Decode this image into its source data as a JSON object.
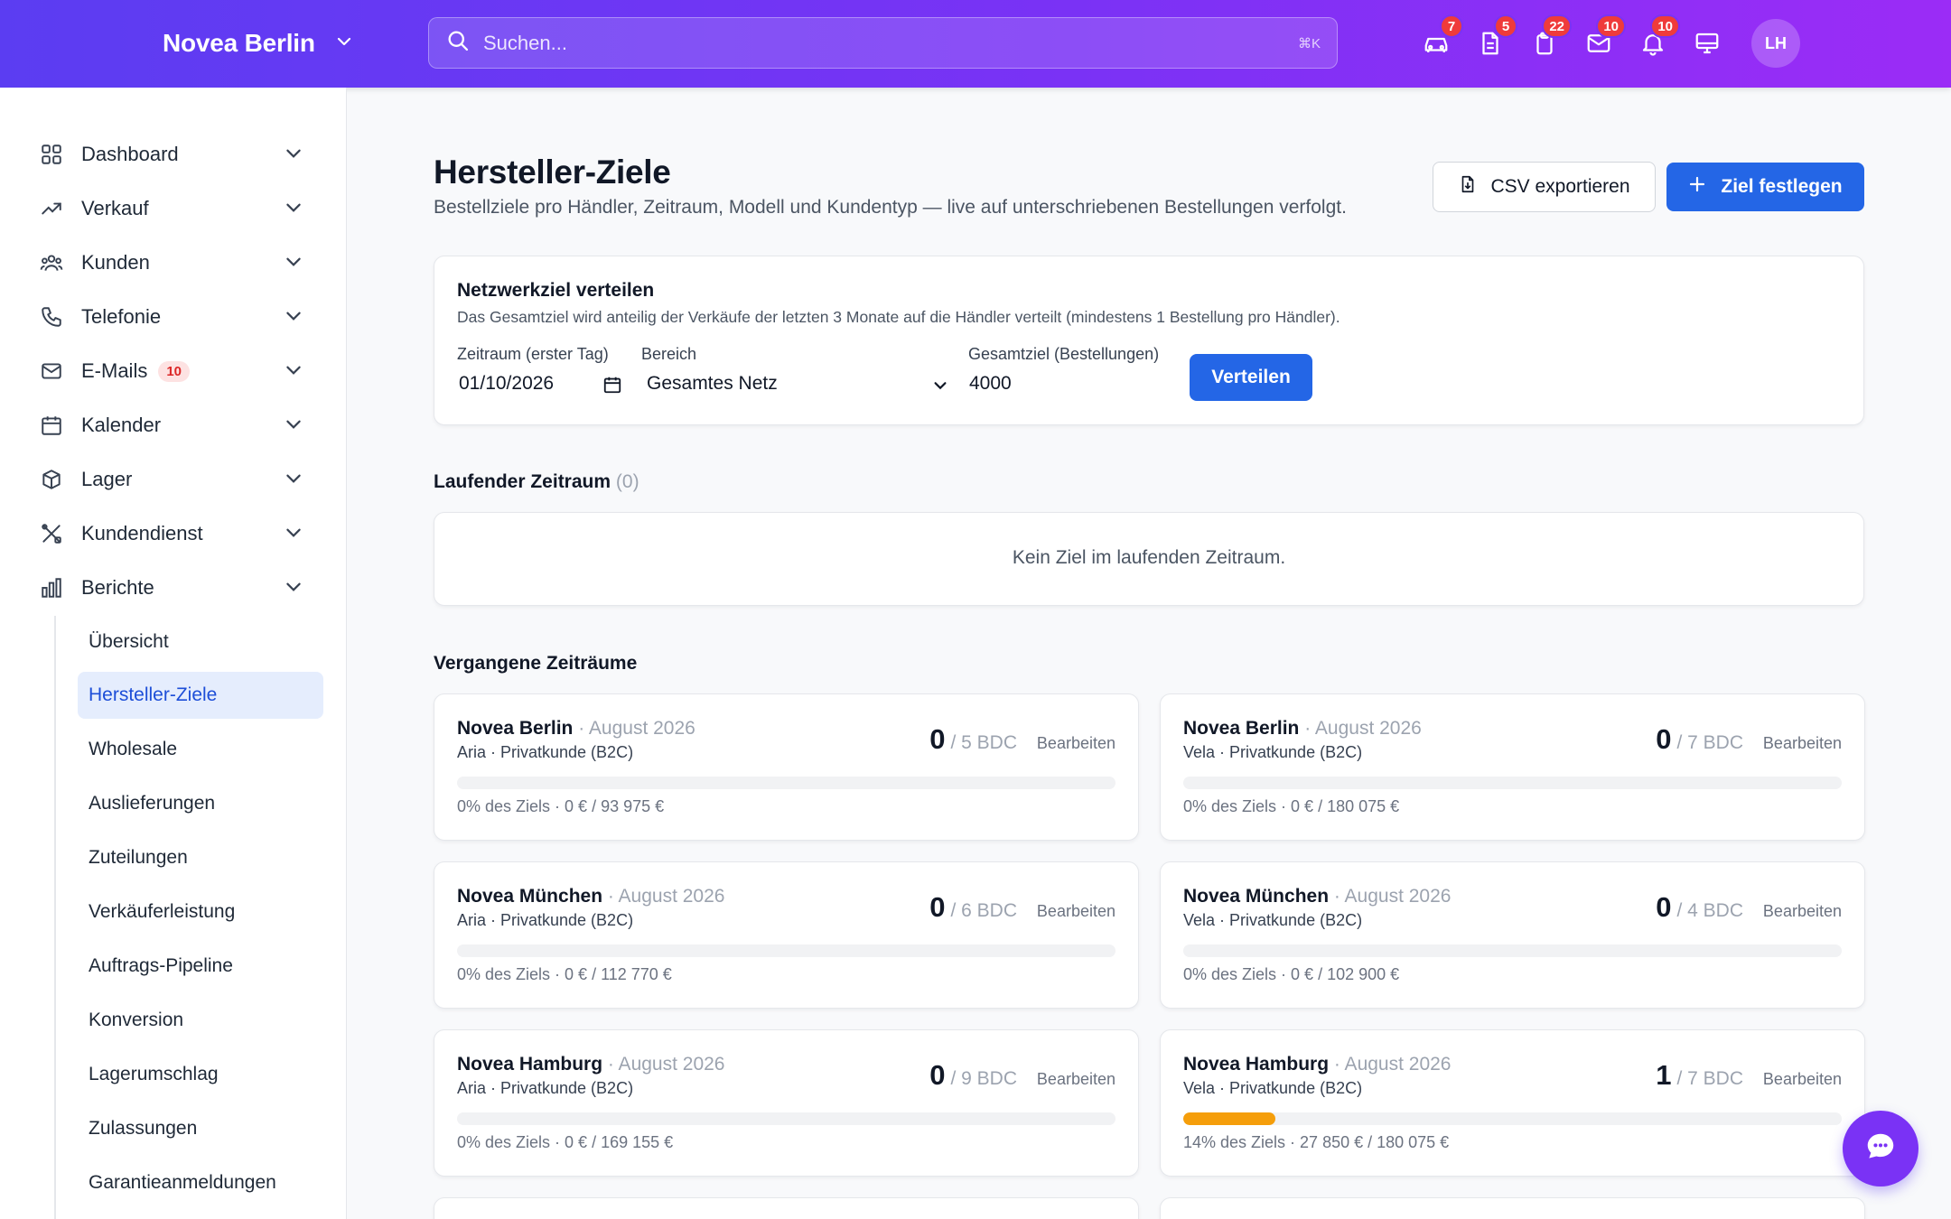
{
  "header": {
    "brand": "Novea Berlin",
    "search_placeholder": "Suchen...",
    "search_shortcut": "⌘K",
    "icons": [
      {
        "name": "car-icon",
        "badge": "7"
      },
      {
        "name": "document-icon",
        "badge": "5"
      },
      {
        "name": "clipboard-icon",
        "badge": "22"
      },
      {
        "name": "mail-icon",
        "badge": "10"
      },
      {
        "name": "bell-icon",
        "badge": "10"
      },
      {
        "name": "monitor-icon",
        "badge": ""
      }
    ],
    "avatar": "LH"
  },
  "sidebar": {
    "items": [
      {
        "label": "Dashboard",
        "icon": "grid-icon"
      },
      {
        "label": "Verkauf",
        "icon": "trending-up-icon"
      },
      {
        "label": "Kunden",
        "icon": "users-icon"
      },
      {
        "label": "Telefonie",
        "icon": "phone-icon"
      },
      {
        "label": "E-Mails",
        "icon": "mail-icon",
        "badge": "10"
      },
      {
        "label": "Kalender",
        "icon": "calendar-icon"
      },
      {
        "label": "Lager",
        "icon": "box-icon"
      },
      {
        "label": "Kundendienst",
        "icon": "tools-icon"
      },
      {
        "label": "Berichte",
        "icon": "bar-chart-icon"
      }
    ],
    "sub_items": [
      {
        "label": "Übersicht"
      },
      {
        "label": "Hersteller-Ziele",
        "active": true
      },
      {
        "label": "Wholesale"
      },
      {
        "label": "Auslieferungen"
      },
      {
        "label": "Zuteilungen"
      },
      {
        "label": "Verkäuferleistung"
      },
      {
        "label": "Auftrags-Pipeline"
      },
      {
        "label": "Konversion"
      },
      {
        "label": "Lagerumschlag"
      },
      {
        "label": "Zulassungen"
      },
      {
        "label": "Garantieanmeldungen"
      }
    ]
  },
  "page": {
    "title": "Hersteller-Ziele",
    "subtitle": "Bestellziele pro Händler, Zeitraum, Modell und Kundentyp — live auf unterschriebenen Bestellungen verfolgt.",
    "csv_button": "CSV exportieren",
    "primary_button": "Ziel festlegen"
  },
  "distribute": {
    "title": "Netzwerkziel verteilen",
    "description": "Das Gesamtziel wird anteilig der Verkäufe der letzten 3 Monate auf die Händler verteilt (mindestens 1 Bestellung pro Händler).",
    "period_label": "Zeitraum (erster Tag)",
    "period_value": "01/10/2026",
    "scope_label": "Bereich",
    "scope_value": "Gesamtes Netz",
    "total_label": "Gesamtziel (Bestellungen)",
    "total_value": "4000",
    "button": "Verteilen"
  },
  "current": {
    "title": "Laufender Zeitraum",
    "count": "(0)",
    "empty": "Kein Ziel im laufenden Zeitraum."
  },
  "past": {
    "title": "Vergangene Zeiträume",
    "edit_label": "Bearbeiten",
    "cards": [
      {
        "dealer": "Novea Berlin",
        "period": "· August 2026",
        "sub": "Aria · Privatkunde (B2C)",
        "actual": "0",
        "target": "/ 5 BDC",
        "progress": 0,
        "footer": "0% des Ziels · 0 € / 93 975 €"
      },
      {
        "dealer": "Novea Berlin",
        "period": "· August 2026",
        "sub": "Vela · Privatkunde (B2C)",
        "actual": "0",
        "target": "/ 7 BDC",
        "progress": 0,
        "footer": "0% des Ziels · 0 € / 180 075 €"
      },
      {
        "dealer": "Novea München",
        "period": "· August 2026",
        "sub": "Aria · Privatkunde (B2C)",
        "actual": "0",
        "target": "/ 6 BDC",
        "progress": 0,
        "footer": "0% des Ziels · 0 € / 112 770 €"
      },
      {
        "dealer": "Novea München",
        "period": "· August 2026",
        "sub": "Vela · Privatkunde (B2C)",
        "actual": "0",
        "target": "/ 4 BDC",
        "progress": 0,
        "footer": "0% des Ziels · 0 € / 102 900 €"
      },
      {
        "dealer": "Novea Hamburg",
        "period": "· August 2026",
        "sub": "Aria · Privatkunde (B2C)",
        "actual": "0",
        "target": "/ 9 BDC",
        "progress": 0,
        "footer": "0% des Ziels · 0 € / 169 155 €"
      },
      {
        "dealer": "Novea Hamburg",
        "period": "· August 2026",
        "sub": "Vela · Privatkunde (B2C)",
        "actual": "1",
        "target": "/ 7 BDC",
        "progress": 0.14,
        "footer": "14% des Ziels · 27 850 € / 180 075 €"
      }
    ]
  },
  "colors": {
    "accent": "#2466e6",
    "header_start": "#5b3df2",
    "header_end": "#9b2cf6",
    "progress": "#f59e0b",
    "badge": "#ef3b3b"
  }
}
